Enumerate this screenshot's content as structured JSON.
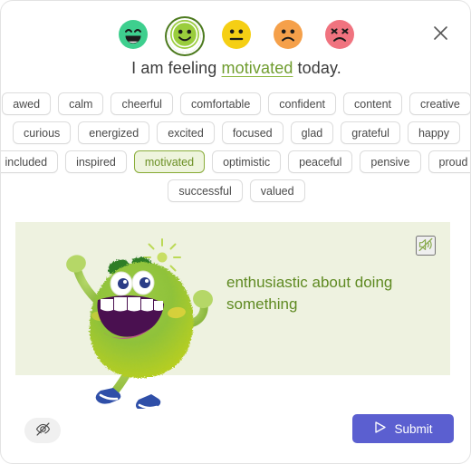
{
  "window": {
    "close_icon": "close-icon"
  },
  "mood_scale": {
    "name": "mood-scale",
    "options": [
      {
        "id": "very-happy",
        "icon": "grinning-face-icon",
        "color": "#3ecf8e",
        "selected": false
      },
      {
        "id": "happy",
        "icon": "smiling-face-icon",
        "color": "#9acd3c",
        "selected": true
      },
      {
        "id": "neutral",
        "icon": "neutral-face-icon",
        "color": "#f5cf14",
        "selected": false
      },
      {
        "id": "sad",
        "icon": "frowning-face-icon",
        "color": "#f5a04a",
        "selected": false
      },
      {
        "id": "very-sad",
        "icon": "distressed-face-icon",
        "color": "#f0737f",
        "selected": false
      }
    ]
  },
  "heading": {
    "prefix": "I am feeling ",
    "word": "motivated",
    "suffix": " today."
  },
  "chips": {
    "selected": "motivated",
    "rows": [
      [
        "awed",
        "calm",
        "cheerful",
        "comfortable",
        "confident",
        "content",
        "creative"
      ],
      [
        "curious",
        "energized",
        "excited",
        "focused",
        "glad",
        "grateful",
        "happy"
      ],
      [
        "included",
        "inspired",
        "motivated",
        "optimistic",
        "peaceful",
        "pensive",
        "proud"
      ],
      [
        "successful",
        "valued"
      ]
    ]
  },
  "card": {
    "definition": "enthusiastic about doing something",
    "mute_icon": "speaker-muted-icon",
    "illustration": "green-monster-character",
    "background_color": "#eef2e0",
    "text_color": "#5f8a22"
  },
  "bottom_bar": {
    "hide_icon": "eye-off-icon",
    "submit_label": "Submit",
    "submit_icon": "send-icon",
    "submit_color": "#5b5fd0"
  }
}
